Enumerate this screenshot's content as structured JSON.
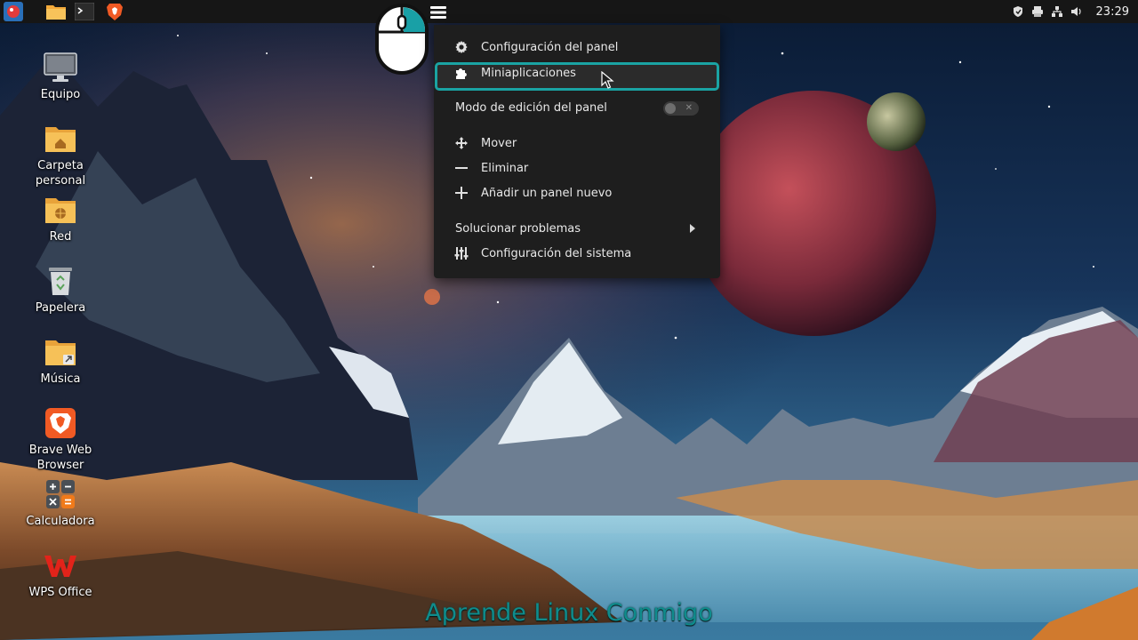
{
  "panel": {
    "clock": "23:29",
    "launchers": [
      "menu-icon",
      "folder-icon",
      "terminal-icon",
      "brave-icon"
    ],
    "tray": [
      "shield-icon",
      "printer-icon",
      "network-icon",
      "volume-icon"
    ]
  },
  "desktop": {
    "icons": [
      {
        "label": "Equipo",
        "icon": "computer-icon"
      },
      {
        "label": "Carpeta personal",
        "icon": "home-folder-icon"
      },
      {
        "label": "Red",
        "icon": "network-folder-icon"
      },
      {
        "label": "Papelera",
        "icon": "trash-icon"
      },
      {
        "label": "Música",
        "icon": "music-folder-icon"
      },
      {
        "label": "Brave Web Browser",
        "icon": "brave-icon"
      },
      {
        "label": "Calculadora",
        "icon": "calculator-icon"
      },
      {
        "label": "WPS Office",
        "icon": "wps-icon"
      }
    ]
  },
  "context_menu": {
    "items": [
      {
        "label": "Configuración del panel",
        "icon": "gear-icon"
      },
      {
        "label": "Miniaplicaciones",
        "icon": "puzzle-icon",
        "highlighted": true
      },
      {
        "label": "Modo de edición del panel",
        "toggle": false
      },
      {
        "label": "Mover",
        "icon": "move-icon"
      },
      {
        "label": "Eliminar",
        "icon": "minus-icon"
      },
      {
        "label": "Añadir un panel nuevo",
        "icon": "plus-icon"
      },
      {
        "label": "Solucionar problemas",
        "submenu": true
      },
      {
        "label": "Configuración del sistema",
        "icon": "sliders-icon"
      }
    ],
    "highlight_color": "#1aa3a3"
  },
  "watermark": "Aprende Linux Conmigo"
}
